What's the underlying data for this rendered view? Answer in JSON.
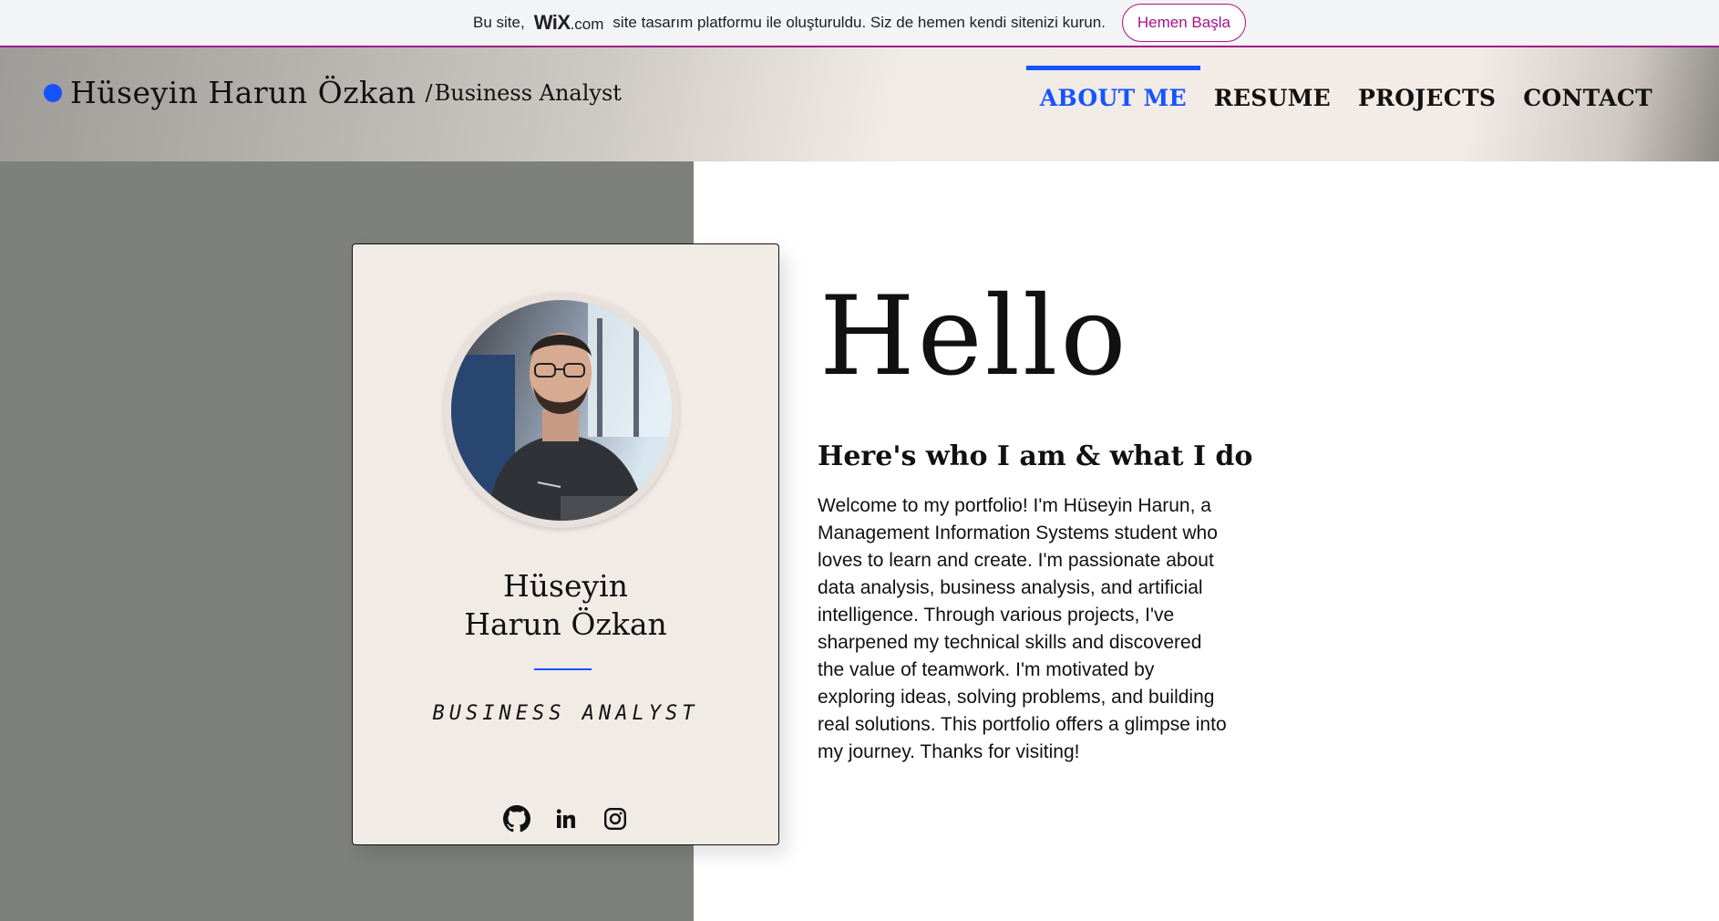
{
  "promo": {
    "text_before": "Bu site,",
    "wix_logo": "WiX",
    "wix_domain": ".com",
    "text_after": "site tasarım platformu ile oluşturuldu. Siz de hemen kendi sitenizi kurun.",
    "button_label": "Hemen Başla",
    "accent_color": "#a3138a"
  },
  "header": {
    "name": "Hüseyin Harun Özkan",
    "separator": "/",
    "role": "Business Analyst",
    "dot_color": "#1553ff"
  },
  "nav": {
    "items": [
      {
        "label": "ABOUT ME",
        "active": true
      },
      {
        "label": "RESUME",
        "active": false
      },
      {
        "label": "PROJECTS",
        "active": false
      },
      {
        "label": "CONTACT",
        "active": false
      }
    ],
    "active_color": "#1553ff"
  },
  "card": {
    "name_line1": "Hüseyin",
    "name_line2": "Harun Özkan",
    "role": "BUSINESS ANALYST",
    "socials": [
      "github-icon",
      "linkedin-icon",
      "instagram-icon"
    ]
  },
  "intro": {
    "heading": "Hello",
    "subtitle": "Here's who I am & what I do",
    "bio": "Welcome to my portfolio! I'm Hüseyin Harun, a Management Information Systems student who loves to learn and create. I'm passionate about data analysis, business analysis, and artificial intelligence. Through various projects, I've sharpened my technical skills and discovered the value of teamwork. I'm motivated by exploring ideas, solving problems, and building real solutions. This portfolio offers a glimpse into my journey. Thanks for visiting!"
  }
}
